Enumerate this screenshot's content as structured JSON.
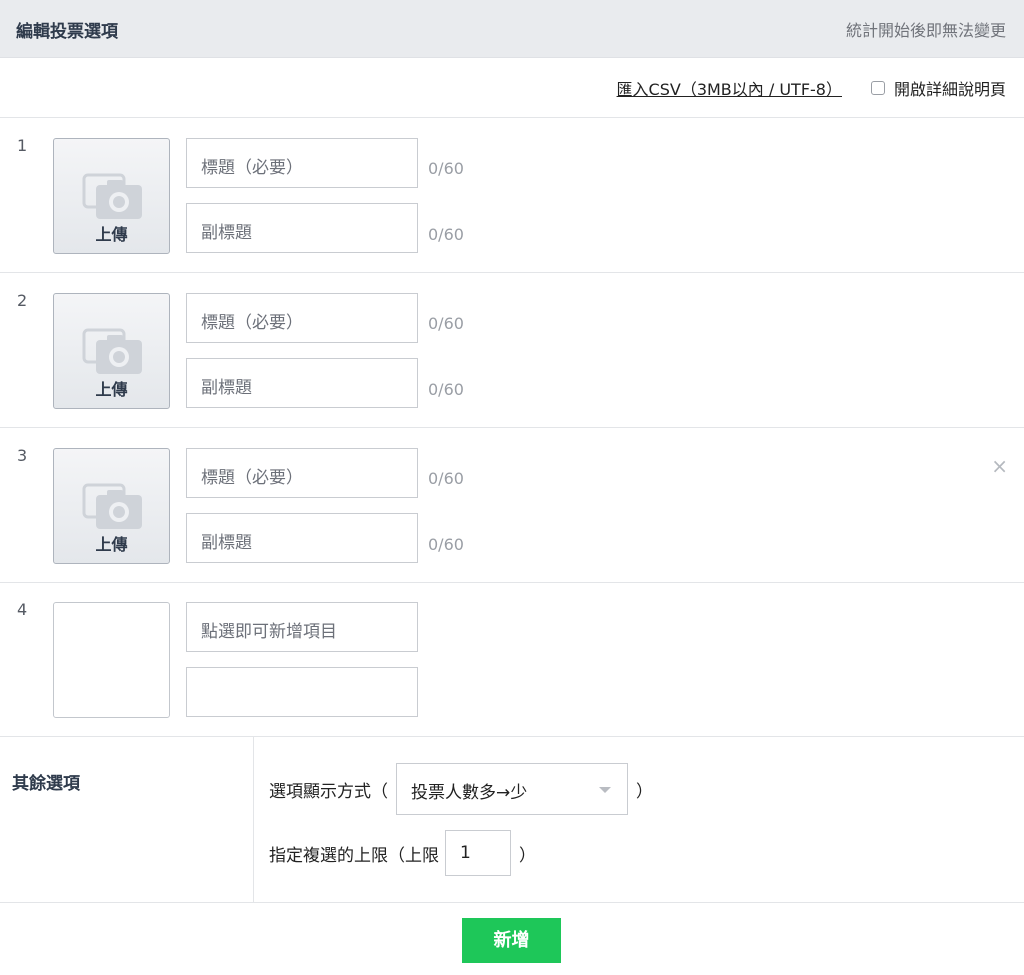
{
  "header": {
    "title": "編輯投票選項",
    "note": "統計開始後即無法變更"
  },
  "toolbar": {
    "csv_link": "匯入CSV（3MB以內 / UTF-8）",
    "detail_label": "開啟詳細說明頁"
  },
  "options": [
    {
      "number": "1",
      "upload_label": "上傳",
      "title_placeholder": "標題（必要）",
      "subtitle_placeholder": "副標題",
      "title_count": "0/60",
      "subtitle_count": "0/60"
    },
    {
      "number": "2",
      "upload_label": "上傳",
      "title_placeholder": "標題（必要）",
      "subtitle_placeholder": "副標題",
      "title_count": "0/60",
      "subtitle_count": "0/60"
    },
    {
      "number": "3",
      "upload_label": "上傳",
      "title_placeholder": "標題（必要）",
      "subtitle_placeholder": "副標題",
      "title_count": "0/60",
      "subtitle_count": "0/60",
      "remove_icon": "×"
    },
    {
      "number": "4",
      "title_placeholder": "點選即可新增項目"
    }
  ],
  "other_options": {
    "title": "其餘選項",
    "display_label": "選項顯示方式（",
    "display_value": "投票人數多→少",
    "display_close": "）",
    "limit_label": "指定複選的上限（上限",
    "limit_value": "1",
    "limit_close": "）"
  },
  "add_button": "新增",
  "icons": {
    "upload": "camera-icon",
    "remove": "close-icon",
    "select_caret": "caret-down-icon"
  },
  "colors": {
    "primary": "#1ec759",
    "header_bg": "#e9ebee",
    "text_dark": "#2f3b4c"
  }
}
